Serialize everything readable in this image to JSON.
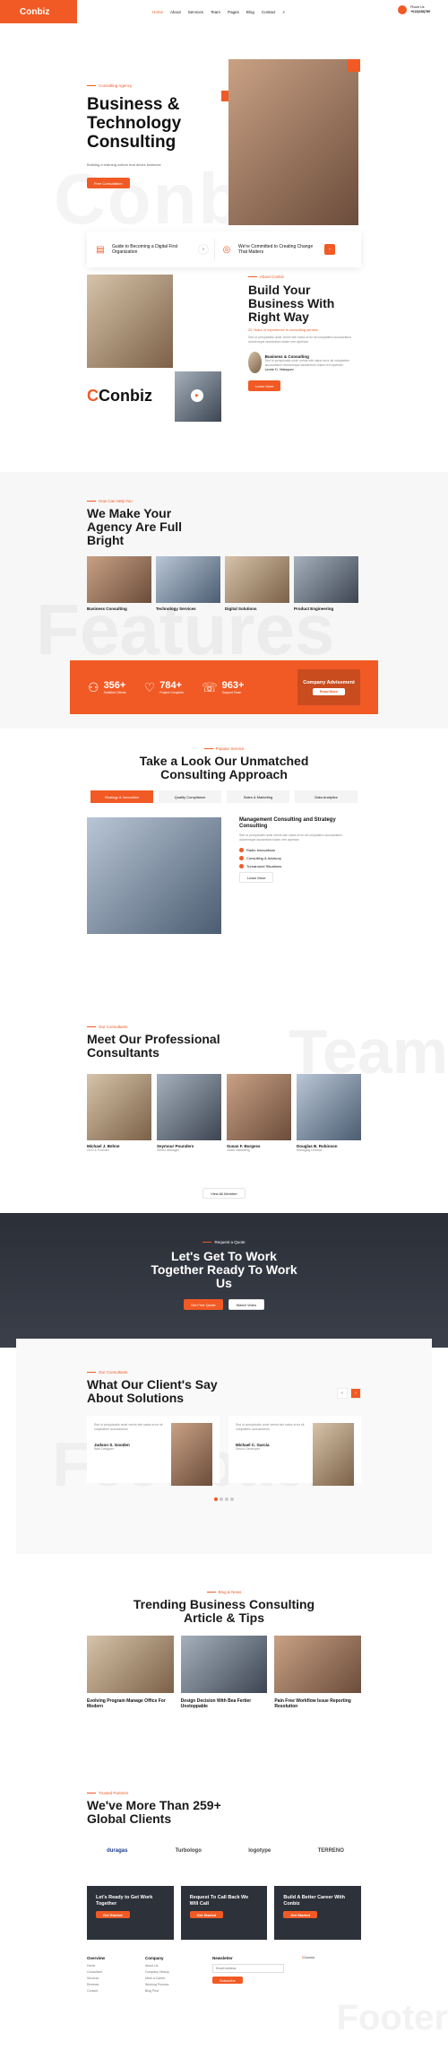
{
  "header": {
    "logo": "Conbiz",
    "nav": [
      "Home",
      "About",
      "Services",
      "Team",
      "Pages",
      "Blog",
      "Contact"
    ],
    "phone_label": "Phone Us",
    "phone_number": "+012(345)789"
  },
  "hero": {
    "eyebrow": "Consulting Agency",
    "title_line1": "Business &",
    "title_line2": "Technology",
    "title_line3": "Consulting",
    "subtitle": "Building a learning culture that drives business",
    "button": "Free Consultation",
    "bg_word": "Conbiz"
  },
  "features": [
    {
      "title": "Guide to Becoming a Digital First Organization"
    },
    {
      "title": "We're Committed to Creating Change That Matters"
    }
  ],
  "about": {
    "eyebrow": "About Conbiz",
    "title": "Build Your Business With Right Way",
    "highlight": "25 Years of experience in consulting service",
    "body": "Sed ut perspiciatis unde omnis iste natus error sit voluptatem accusantium doloremque laudantium totam rem aperiam",
    "quote_title": "Business & Consulting",
    "quote_name": "Leonie D. Velasquez",
    "button": "Learn More",
    "logo": "Conbiz"
  },
  "services": {
    "eyebrow": "How Can Help You",
    "title": "We Make Your Agency Are Full Bright",
    "bg_word": "Features",
    "items": [
      "Business Consulting",
      "Technology Services",
      "Digital Solutions",
      "Product Engineering"
    ]
  },
  "stats": [
    {
      "num": "356+",
      "cap": "Satisfied Clients"
    },
    {
      "num": "784+",
      "cap": "Project Complete"
    },
    {
      "num": "963+",
      "cap": "Support Team"
    }
  ],
  "advisement": {
    "title": "Company Advisement",
    "button": "Read More"
  },
  "approach": {
    "eyebrow": "Popular Service",
    "title": "Take a Look Our Unmatched Consulting Approach",
    "tabs": [
      "Strategy & Innovation",
      "Quality Compliance",
      "Sales & Marketing",
      "Data Analytics"
    ],
    "heading": "Management Consulting and Strategy Consulting",
    "body": "Sed ut perspiciatis unde omnis iste natus error sit voluptatem accusantium doloremque laudantium totam rem aperiam",
    "list": [
      "Radio Innovations",
      "Consulting & Advisory",
      "Turnaround Situations"
    ],
    "button": "Learn More"
  },
  "team": {
    "eyebrow": "Our Consultants",
    "title": "Meet Our Professional Consultants",
    "bg_word": "Team",
    "members": [
      {
        "name": "Michael J. Behne",
        "role": "CEO & Founder"
      },
      {
        "name": "Seymour Pounders",
        "role": "Senior Manager"
      },
      {
        "name": "Susan F. Burgess",
        "role": "Junior Marketing"
      },
      {
        "name": "Douglas B. Robinson",
        "role": "Managing Director"
      }
    ],
    "button": "View All Member"
  },
  "quote": {
    "eyebrow": "Request a Quote",
    "title": "Let's Get To Work Together Ready To Work Us",
    "button1": "Get Free Quote",
    "button2": "Watch Video"
  },
  "testimonials": {
    "eyebrow": "Our Consultants",
    "title": "What Our Client's Say About Solutions",
    "bg_word": "Feedback",
    "items": [
      {
        "text": "Sed ut perspiciatis unde omnis iste natus error sit voluptatem accusantium",
        "name": "Judson S. Gooden",
        "role": "Web Designer"
      },
      {
        "text": "Sed ut perspiciatis unde omnis iste natus error sit voluptatem accusantium",
        "name": "Michael C. Garcia",
        "role": "Senior Developer"
      }
    ]
  },
  "blog": {
    "eyebrow": "Blog & News",
    "title": "Trending Business Consulting Article & Tips",
    "posts": [
      {
        "title": "Evolving Program Manage Office For Modern"
      },
      {
        "title": "Design Decision With Bea Fertier Unstoppable"
      },
      {
        "title": "Pain Free Workflow Issue Reporting Resolution"
      }
    ]
  },
  "clients": {
    "eyebrow": "Trusted Partners",
    "title": "We've More Than 259+ Global Clients",
    "brands": [
      "duragas",
      "Turbologo",
      "logotype",
      "TERRENO"
    ]
  },
  "ctas": [
    {
      "title": "Let's Ready to Get Work Together",
      "button": "Get Started"
    },
    {
      "title": "Request To Call Back We Will Call",
      "button": "Get Started"
    },
    {
      "title": "Build A Better Career With Conbiz",
      "button": "Get Started"
    }
  ],
  "footer": {
    "col1_title": "Overview",
    "col1": [
      "Home",
      "Consultant",
      "Services",
      "Reviews",
      "Contact"
    ],
    "col2_title": "Company",
    "col2": [
      "About Us",
      "Company History",
      "Meet a Career",
      "Working Process",
      "Blog Post"
    ],
    "col3_title": "Newsletter",
    "email_placeholder": "Email Address",
    "subscribe": "Subscribe",
    "logo": "Conbiz",
    "bg_word": "Footer"
  }
}
